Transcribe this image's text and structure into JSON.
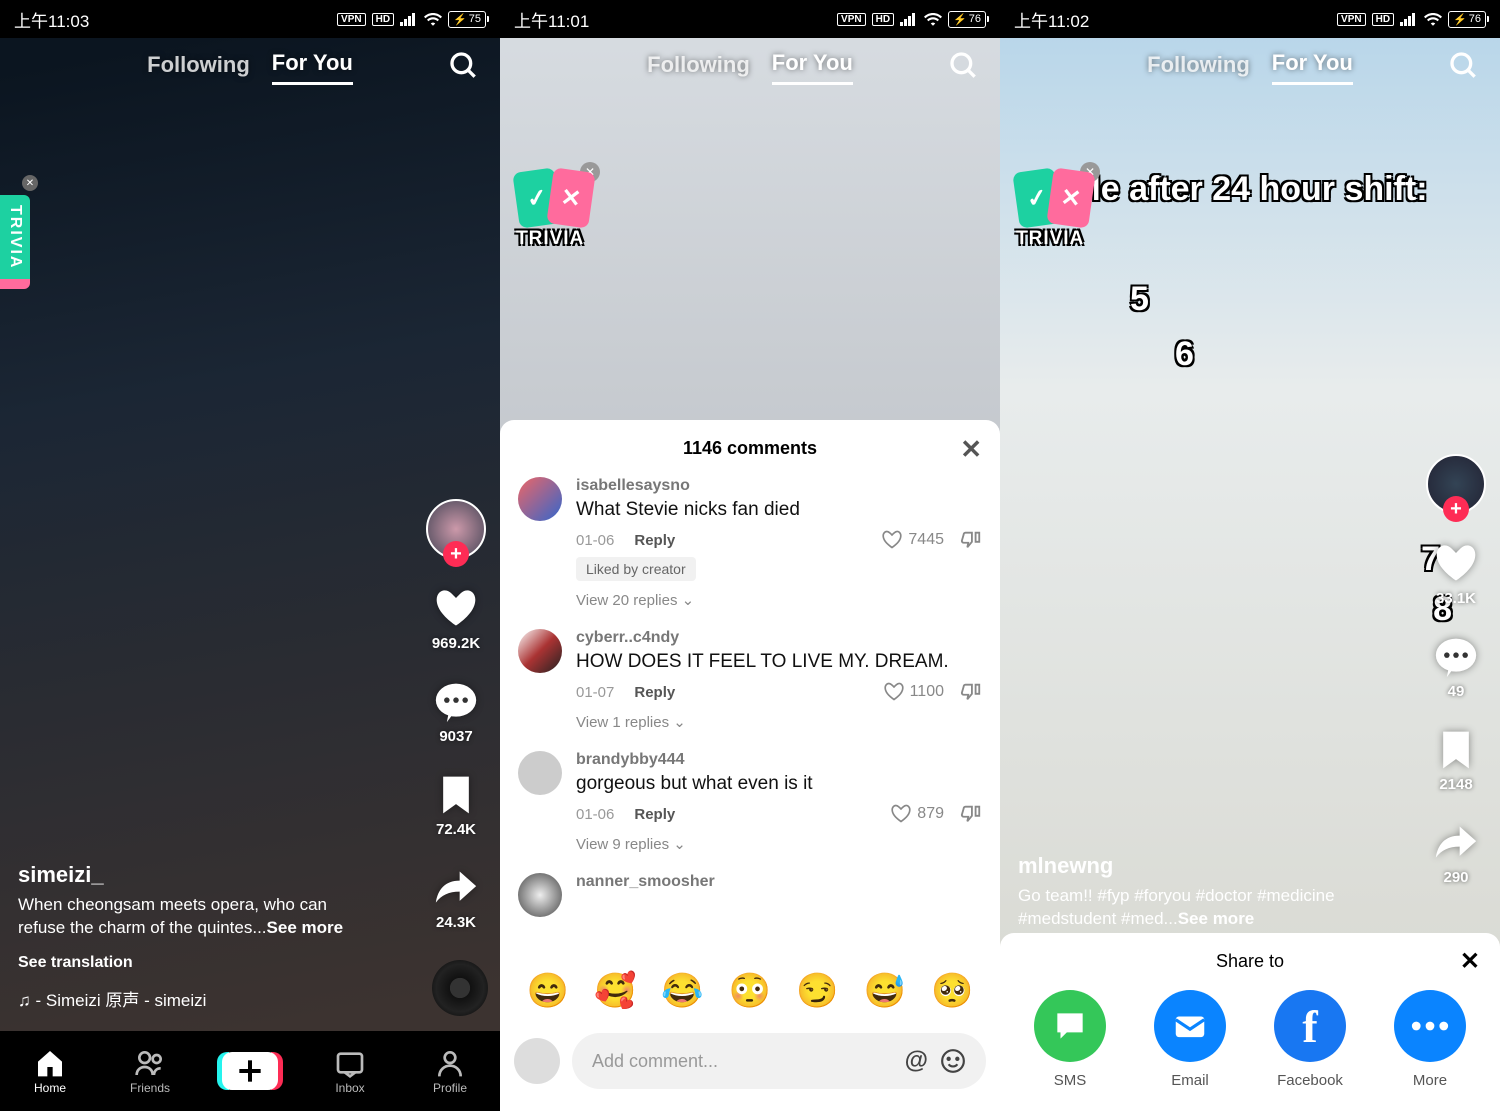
{
  "screens": [
    {
      "status": {
        "time": "上午11:03",
        "vpn": "VPN",
        "hd": "HD",
        "battery": "75"
      },
      "nav": {
        "following": "Following",
        "foryou": "For You"
      },
      "trivia": "TRIVIA",
      "username": "simeizi_",
      "caption": "When cheongsam meets opera, who can refuse the charm of the quintes...",
      "seemore": "See more",
      "translation": "See translation",
      "sound": "♫ - Simeizi   原声 - simeizi",
      "rail": {
        "likes": "969.2K",
        "comments": "9037",
        "saves": "72.4K",
        "shares": "24.3K"
      },
      "bottom": {
        "home": "Home",
        "friends": "Friends",
        "inbox": "Inbox",
        "profile": "Profile"
      }
    },
    {
      "status": {
        "time": "上午11:01",
        "vpn": "VPN",
        "hd": "HD",
        "battery": "76"
      },
      "nav": {
        "following": "Following",
        "foryou": "For You"
      },
      "trivia": "TRIVIA",
      "comments_title": "1146 comments",
      "comments": [
        {
          "user": "isabellesaysno",
          "text": "What Stevie nicks fan died",
          "date": "01-06",
          "reply": "Reply",
          "likes": "7445",
          "liked_by": "Liked by creator",
          "replies": "View 20 replies"
        },
        {
          "user": "cyberr..c4ndy",
          "text": "HOW DOES IT FEEL TO LIVE MY. DREAM.",
          "date": "01-07",
          "reply": "Reply",
          "likes": "1100",
          "replies": "View 1 replies"
        },
        {
          "user": "brandybby444",
          "text": "gorgeous but what even is it",
          "date": "01-06",
          "reply": "Reply",
          "likes": "879",
          "replies": "View 9 replies"
        },
        {
          "user": "nanner_smoosher",
          "text": "",
          "date": "",
          "reply": "",
          "likes": "",
          "replies": ""
        }
      ],
      "emojis": [
        "😄",
        "🥰",
        "😂",
        "😳",
        "😏",
        "😅",
        "🥺"
      ],
      "input_placeholder": "Add comment..."
    },
    {
      "status": {
        "time": "上午11:02",
        "vpn": "VPN",
        "hd": "HD",
        "battery": "76"
      },
      "nav": {
        "following": "Following",
        "foryou": "For You"
      },
      "trivia": "TRIVIA",
      "overlay": "Me after 24 hour shift:",
      "numbers": [
        "5",
        "6",
        "7",
        "8"
      ],
      "username": "mlnewng",
      "caption": "Go team!! #fyp #foryou #doctor #medicine #medstudent #med...",
      "seemore": "See more",
      "rail": {
        "likes": "33.1K",
        "comments": "49",
        "saves": "2148",
        "shares": "290"
      },
      "share": {
        "title": "Share to",
        "items": [
          {
            "label": "SMS",
            "color": "#34c759"
          },
          {
            "label": "Email",
            "color": "#0a84ff"
          },
          {
            "label": "Facebook",
            "color": "#1877f2"
          },
          {
            "label": "More",
            "color": "#0a84ff"
          }
        ]
      }
    }
  ]
}
